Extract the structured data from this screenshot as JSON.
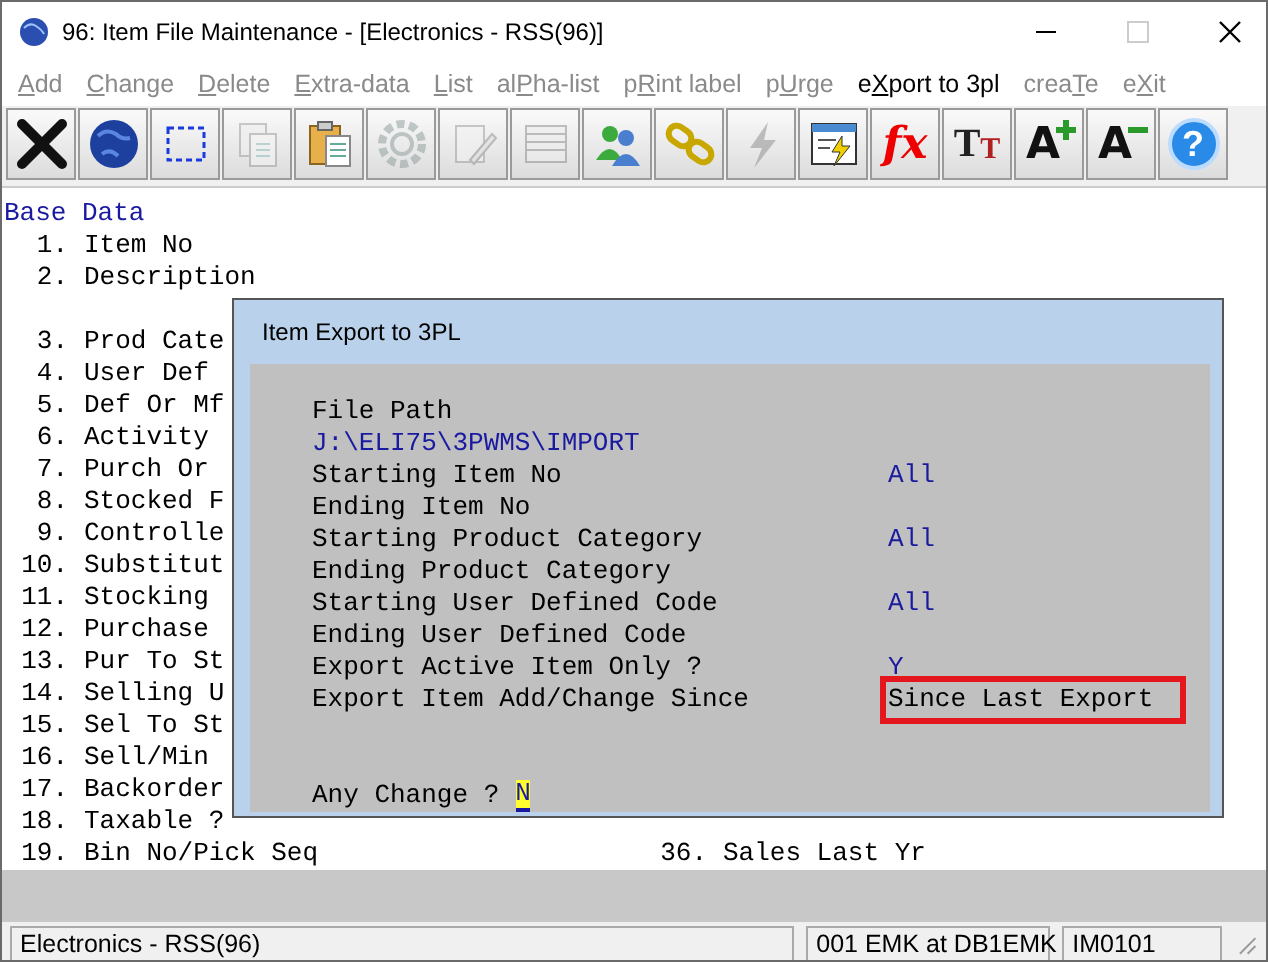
{
  "window": {
    "title": "96: Item File Maintenance - [Electronics - RSS(96)]"
  },
  "menu": [
    {
      "key": "A",
      "after": "dd",
      "disabled": true
    },
    {
      "key": "C",
      "after": "hange",
      "disabled": true
    },
    {
      "key": "D",
      "after": "elete",
      "disabled": true
    },
    {
      "key": "E",
      "after": "xtra-data",
      "disabled": true
    },
    {
      "key": "L",
      "after": "ist",
      "disabled": true
    },
    {
      "before": "al",
      "key": "P",
      "after": "ha-list",
      "disabled": true
    },
    {
      "before": "p",
      "key": "R",
      "after": "int label",
      "disabled": true
    },
    {
      "before": "p",
      "key": "U",
      "after": "rge",
      "disabled": true
    },
    {
      "before": "e",
      "key": "X",
      "after": "port to 3pl",
      "disabled": false
    },
    {
      "before": "crea",
      "key": "T",
      "after": "e",
      "disabled": true
    },
    {
      "before": "e",
      "key": "X",
      "after": "it",
      "disabled": true
    }
  ],
  "toolbar": [
    {
      "kind": "close",
      "disabled": false
    },
    {
      "kind": "globe",
      "disabled": false
    },
    {
      "kind": "select",
      "disabled": false
    },
    {
      "kind": "copy",
      "disabled": true
    },
    {
      "kind": "paste",
      "disabled": false
    },
    {
      "kind": "gear",
      "disabled": true
    },
    {
      "kind": "edit",
      "disabled": true
    },
    {
      "kind": "list",
      "disabled": true
    },
    {
      "kind": "users",
      "disabled": false
    },
    {
      "kind": "link",
      "disabled": false
    },
    {
      "kind": "lightning",
      "disabled": true
    },
    {
      "kind": "report",
      "disabled": false
    },
    {
      "kind": "formula",
      "glyph": "fx",
      "disabled": false
    },
    {
      "kind": "font",
      "glyph": "T",
      "glyph2": "T",
      "disabled": false
    },
    {
      "kind": "font-bigger",
      "glyph": "A",
      "disabled": false
    },
    {
      "kind": "font-smaller",
      "glyph": "A",
      "disabled": false
    },
    {
      "kind": "help",
      "glyph": "?",
      "disabled": false
    }
  ],
  "section_title": "Base Data",
  "fields": [
    {
      "kind": "field",
      "number": "1.",
      "label": "Item No"
    },
    {
      "kind": "field",
      "number": "2.",
      "label": "Description"
    },
    {
      "kind": "gap"
    },
    {
      "kind": "field",
      "number": "3.",
      "label": "Prod Cate"
    },
    {
      "kind": "field",
      "number": "4.",
      "label": "User Def"
    },
    {
      "kind": "field",
      "number": "5.",
      "label": "Def Or Mf"
    },
    {
      "kind": "field",
      "number": "6.",
      "label": "Activity"
    },
    {
      "kind": "field",
      "number": "7.",
      "label": "Purch Or"
    },
    {
      "kind": "field",
      "number": "8.",
      "label": "Stocked F"
    },
    {
      "kind": "field",
      "number": "9.",
      "label": "Controlle"
    },
    {
      "kind": "field",
      "number": "10.",
      "label": "Substitut"
    },
    {
      "kind": "field",
      "number": "11.",
      "label": "Stocking"
    },
    {
      "kind": "field",
      "number": "12.",
      "label": "Purchase"
    },
    {
      "kind": "field",
      "number": "13.",
      "label": "Pur To St"
    },
    {
      "kind": "field",
      "number": "14.",
      "label": "Selling U"
    },
    {
      "kind": "field",
      "number": "15.",
      "label": "Sel To St"
    },
    {
      "kind": "field",
      "number": "16.",
      "label": "Sell/Min"
    },
    {
      "kind": "field",
      "number": "17.",
      "label": "Backorder"
    },
    {
      "kind": "field",
      "number": "18.",
      "label": "Taxable ?"
    },
    {
      "kind": "field",
      "number": "19.",
      "label": "Bin No/Pick Seq"
    }
  ],
  "right_fields": [
    {
      "number": "36.",
      "label": "Sales Last Yr"
    }
  ],
  "dialog": {
    "title": "Item Export to 3PL",
    "rows": [
      {
        "kind": "label",
        "label": "File Path"
      },
      {
        "kind": "path",
        "text": "J:\\ELI75\\3PWMS\\IMPORT"
      },
      {
        "kind": "field",
        "label": "Starting Item No",
        "value": "All"
      },
      {
        "kind": "field",
        "label": "Ending Item No"
      },
      {
        "kind": "field",
        "label": "Starting Product Category",
        "value": "All"
      },
      {
        "kind": "field",
        "label": "Ending Product Category"
      },
      {
        "kind": "field",
        "label": "Starting User Defined Code",
        "value": "All"
      },
      {
        "kind": "field",
        "label": "Ending User Defined Code"
      },
      {
        "kind": "field",
        "label": "Export Active Item Only ?",
        "value": "Y"
      },
      {
        "kind": "field",
        "label": "Export Item Add/Change Since",
        "value": "Since Last Export",
        "highlighted": true
      }
    ],
    "prompt": {
      "label": "Any Change ?",
      "value": "N"
    }
  },
  "status_bar": [
    "Electronics - RSS(96)",
    "001 EMK at DB1EMK",
    "IM0101"
  ]
}
